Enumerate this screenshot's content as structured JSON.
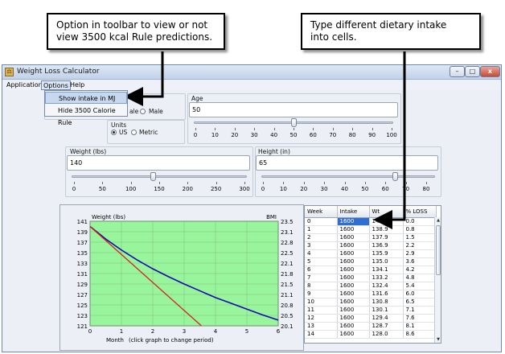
{
  "callouts": {
    "toolbar_note": "Option in toolbar to view or not\nview 3500 kcal Rule predictions.",
    "cells_note": "Type different dietary intake\ninto cells."
  },
  "window": {
    "title": "Weight Loss Calculator",
    "buttons": [
      "–",
      "□",
      "x"
    ]
  },
  "menu": {
    "items": [
      "Application",
      "Options",
      "Help"
    ],
    "options_dropdown": [
      "Show intake in MJ",
      "Hide 3500 Calorie Rule"
    ]
  },
  "gender": {
    "female_label_partial": "ale",
    "male_label": "Male"
  },
  "units": {
    "label": "Units",
    "us_label": "US",
    "metric_label": "Metric",
    "selected": "US"
  },
  "age": {
    "label": "Age",
    "value": "50",
    "ticks": [
      "0",
      "10",
      "20",
      "30",
      "40",
      "50",
      "60",
      "70",
      "80",
      "90",
      "100"
    ],
    "min": 0,
    "max": 100,
    "level": 50
  },
  "weight": {
    "label": "Weight (lbs)",
    "value": "140",
    "ticks": [
      "0",
      "50",
      "100",
      "150",
      "200",
      "250",
      "300"
    ],
    "min": 0,
    "max": 300,
    "level": 140
  },
  "height": {
    "label": "Height (in)",
    "value": "65",
    "ticks": [
      "0",
      "10",
      "20",
      "30",
      "40",
      "50",
      "60",
      "70",
      "80"
    ],
    "min": 0,
    "max": 80,
    "level": 65
  },
  "chart_data": {
    "type": "line",
    "title": "",
    "ylabel_left": "Weight (lbs)",
    "ylabel_right": "BMI",
    "xlabel": "Month",
    "note": "(click graph to change period)",
    "xlim": [
      0,
      6
    ],
    "ylim": [
      121,
      141
    ],
    "ylim_right": [
      20.1,
      23.5
    ],
    "x_ticks": [
      "0",
      "1",
      "2",
      "3",
      "4",
      "5",
      "6"
    ],
    "y_ticks": [
      "141",
      "139",
      "137",
      "135",
      "133",
      "131",
      "129",
      "127",
      "125",
      "123",
      "121"
    ],
    "y_ticks_right": [
      "23.5",
      "23.1",
      "22.8",
      "22.5",
      "22.1",
      "21.8",
      "21.5",
      "21.1",
      "20.8",
      "20.5",
      "20.1"
    ],
    "background": "#99f59c",
    "grid": true,
    "series": [
      {
        "color": "#0a0ab0",
        "x": [
          0,
          0.5,
          1,
          1.5,
          2,
          2.5,
          3,
          3.5,
          4,
          4.5,
          5,
          5.5,
          6
        ],
        "values": [
          140,
          137.6,
          135.5,
          133.6,
          131.9,
          130.4,
          129.0,
          127.7,
          126.4,
          125.3,
          124.2,
          123.1,
          122.1
        ]
      },
      {
        "color": "#d62020",
        "x": [
          0,
          3.55
        ],
        "values": [
          140,
          121
        ]
      }
    ]
  },
  "table": {
    "headers": [
      "Week",
      "Intake",
      "Wt",
      "% LOSS"
    ],
    "rows": [
      [
        "0",
        "1600",
        "140",
        "0.0"
      ],
      [
        "1",
        "1600",
        "138.9",
        "0.8"
      ],
      [
        "2",
        "1600",
        "137.9",
        "1.5"
      ],
      [
        "3",
        "1600",
        "136.9",
        "2.2"
      ],
      [
        "4",
        "1600",
        "135.9",
        "2.9"
      ],
      [
        "5",
        "1600",
        "135.0",
        "3.6"
      ],
      [
        "6",
        "1600",
        "134.1",
        "4.2"
      ],
      [
        "7",
        "1600",
        "133.2",
        "4.8"
      ],
      [
        "8",
        "1600",
        "132.4",
        "5.4"
      ],
      [
        "9",
        "1600",
        "131.6",
        "6.0"
      ],
      [
        "10",
        "1600",
        "130.8",
        "6.5"
      ],
      [
        "11",
        "1600",
        "130.1",
        "7.1"
      ],
      [
        "12",
        "1600",
        "129.4",
        "7.6"
      ],
      [
        "13",
        "1600",
        "128.7",
        "8.1"
      ],
      [
        "14",
        "1600",
        "128.0",
        "8.6"
      ]
    ],
    "scroll_up": "▲",
    "scroll_down": "▼"
  }
}
